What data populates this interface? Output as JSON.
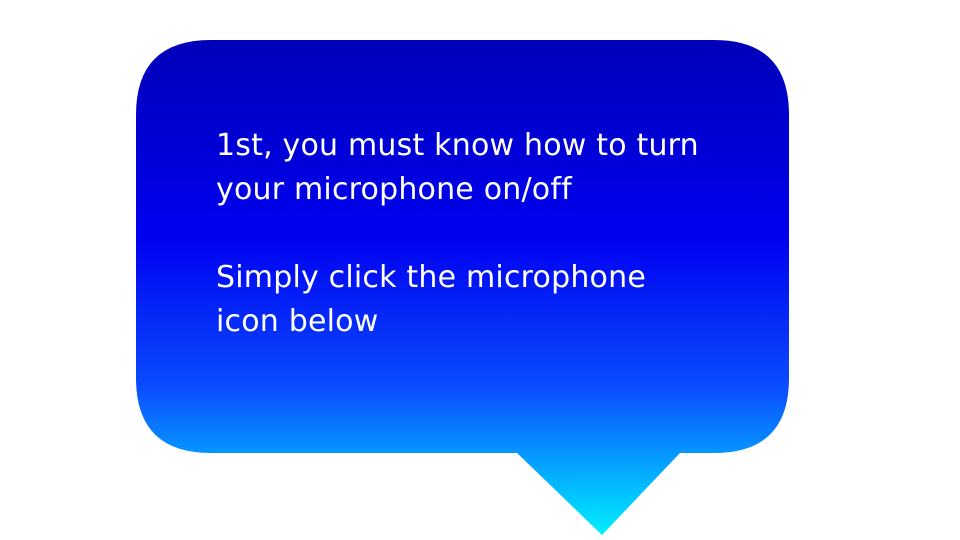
{
  "bubble": {
    "line1": "1st, you must know how to turn\nyour microphone on/off",
    "line2": "Simply click the microphone\nicon below"
  },
  "colors": {
    "gradient_top": "#0000b8",
    "gradient_mid": "#0000f0",
    "gradient_bottom": "#00f0ff",
    "text": "#ffffff"
  }
}
